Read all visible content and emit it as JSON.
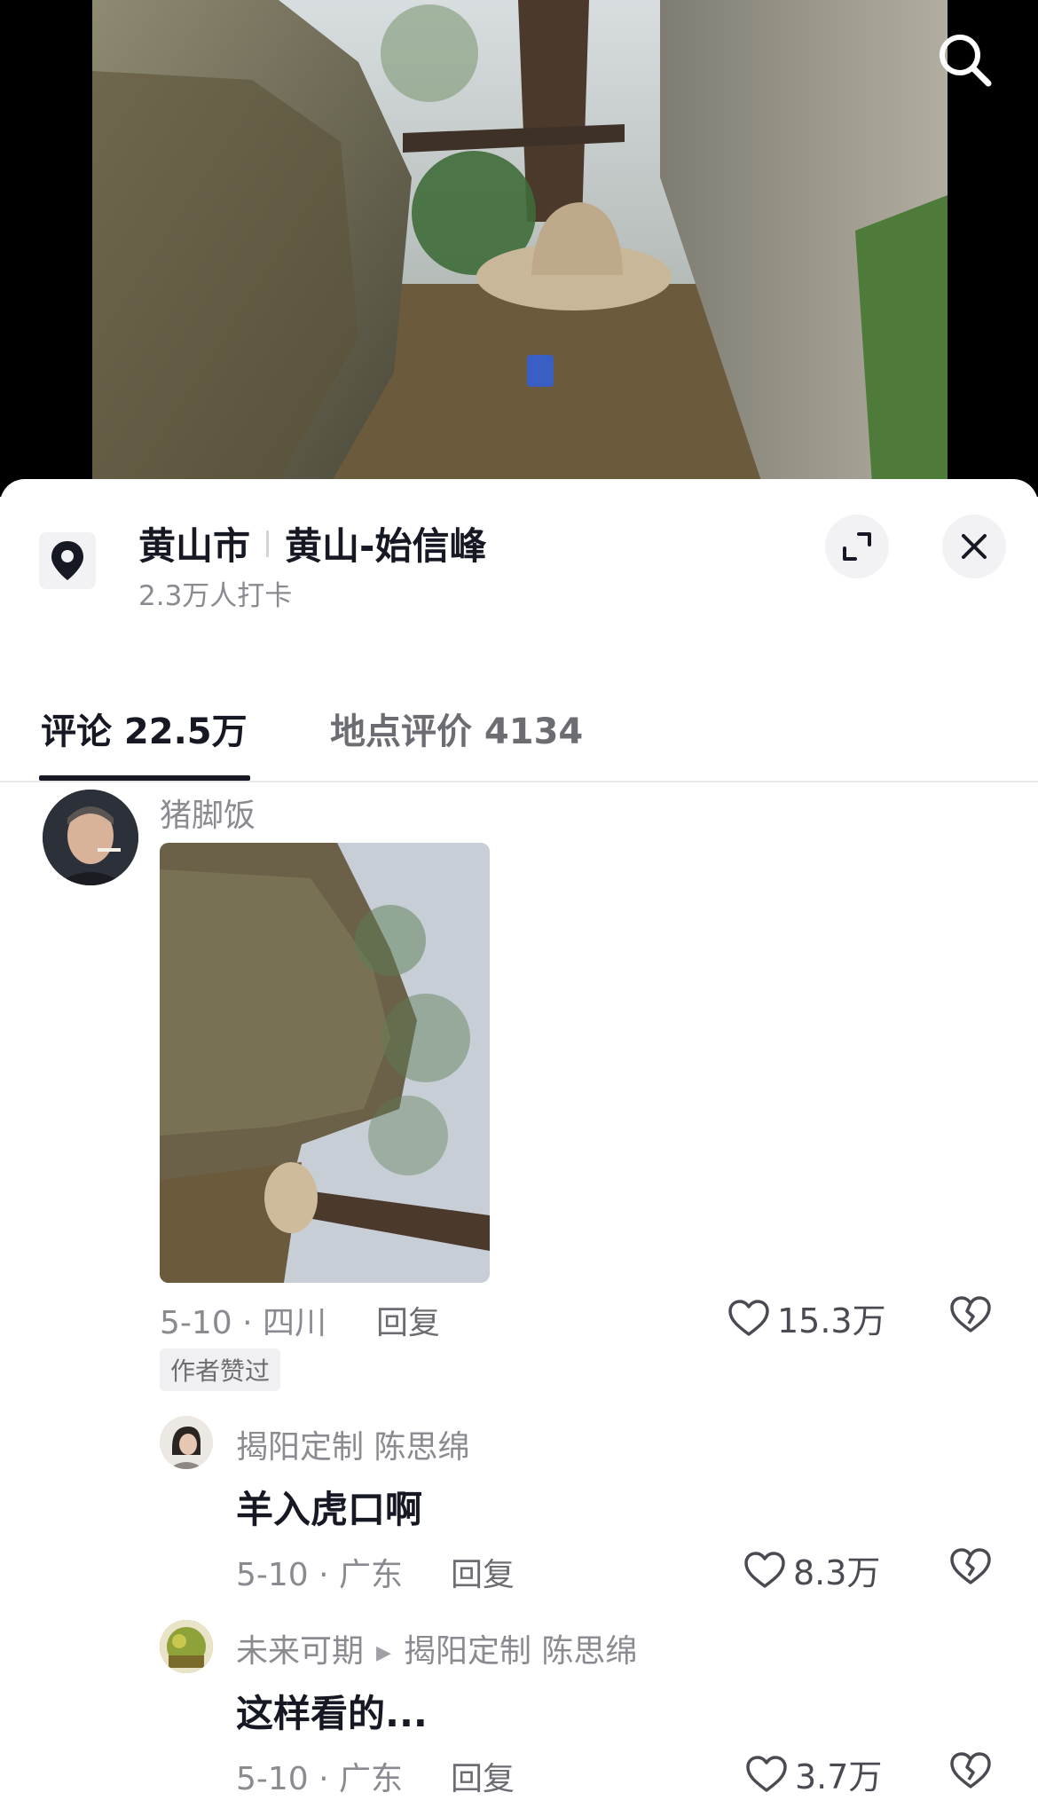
{
  "location": {
    "city": "黄山市",
    "place": "黄山-始信峰",
    "checkins": "2.3万人打卡"
  },
  "tabs": [
    {
      "label": "评论 22.5万"
    },
    {
      "label": "地点评价 4134"
    }
  ],
  "comments": [
    {
      "user": "猪脚饭",
      "date_loc": "5-10 · 四川",
      "reply": "回复",
      "likes": "15.3万",
      "badge": "作者赞过"
    }
  ],
  "replies": [
    {
      "user": "揭阳定制 陈思绵",
      "text": "羊入虎口啊",
      "date_loc": "5-10 · 广东",
      "reply": "回复",
      "likes": "8.3万"
    },
    {
      "user": "未来可期",
      "reply_to": "揭阳定制 陈思绵",
      "text": "这样看的...",
      "date_loc": "5-10 · 广东",
      "reply": "回复",
      "likes": "3.7万"
    }
  ],
  "icons": {
    "search": "search-icon",
    "location": "location-pin-icon",
    "expand": "expand-icon",
    "close": "close-icon",
    "like": "heart-icon",
    "dislike": "broken-heart-icon"
  }
}
